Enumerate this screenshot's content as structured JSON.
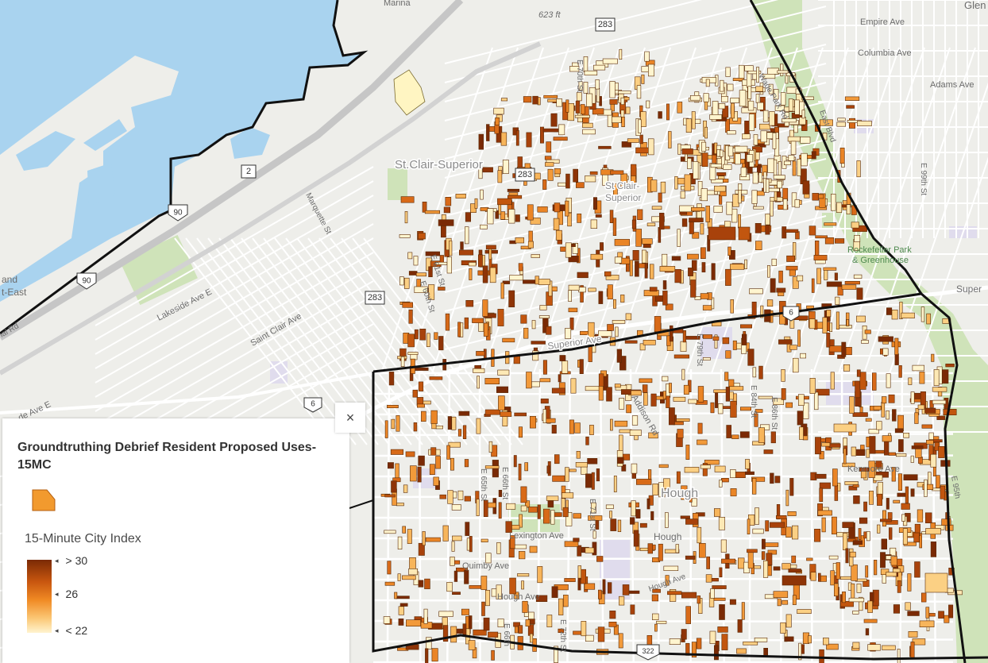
{
  "legend": {
    "layer_title": "Groundtruthing Debrief Resident Proposed Uses- 15MC",
    "index_title": "15-Minute City Index",
    "ticks": [
      "> 30",
      "26",
      "< 22"
    ],
    "close_glyph": "×",
    "swatch_color": "#f29a2e"
  },
  "map_labels": {
    "glen": "Glen",
    "marina": "Marina",
    "elev": "623 ft",
    "empire": "Empire Ave",
    "columbia": "Columbia Ave",
    "adams": "Adams Ave",
    "e70": "E 70th St",
    "wade": "Wade Park Rd",
    "east_blvd": "East Blvd",
    "e99": "E 99th St",
    "stclair_superior": "St.Clair-Superior",
    "stclair_sup_inner1": "St Clair-",
    "stclair_sup_inner2": "Superior",
    "marquette": "Marquette St",
    "lakeside": "Lakeside Ave E",
    "stclair_ave": "Saint Clair Ave",
    "e61": "E 61st St",
    "e60": "E 60th St",
    "rockefeller1": "Rockefeller Park",
    "rockefeller2": "& Greenhouse",
    "superior_ave": "Superior Ave",
    "super_edge": "Super",
    "e79": "E 79th St",
    "hudson": "Addison Rd",
    "e84": "E 84th St",
    "e86": "E 86th St",
    "kenmore": "Kenmore Ave",
    "hough_big": "Hough",
    "hough_small": "Hough",
    "lexington": "Lexington Ave",
    "quimby": "Quimby Ave",
    "hough_ave1": "Hough Ave",
    "hough_ave2": "Hough Ave",
    "e66": "E 66th St",
    "e71": "E 71st St",
    "e65": "E 65th St",
    "e66b": "E 66th",
    "e72": "E 72th St",
    "ave_e": "de Ave E",
    "and": "and",
    "t_east": "t-East",
    "ial_rd": "ial Rd",
    "cs_left": "E 95th"
  },
  "shields": {
    "r283a": "283",
    "r283b": "283",
    "r283c": "283",
    "r2": "2",
    "i90a": "90",
    "i90b": "90",
    "us6a": "6",
    "us6b": "6",
    "us322": "322"
  },
  "colors": {
    "water": "#a9d3ef",
    "land": "#eeeeea",
    "park": "#cfe3b9",
    "highway": "#c6c6c6",
    "boundary": "#111111",
    "parcel_stroke": "#5a2a05"
  }
}
